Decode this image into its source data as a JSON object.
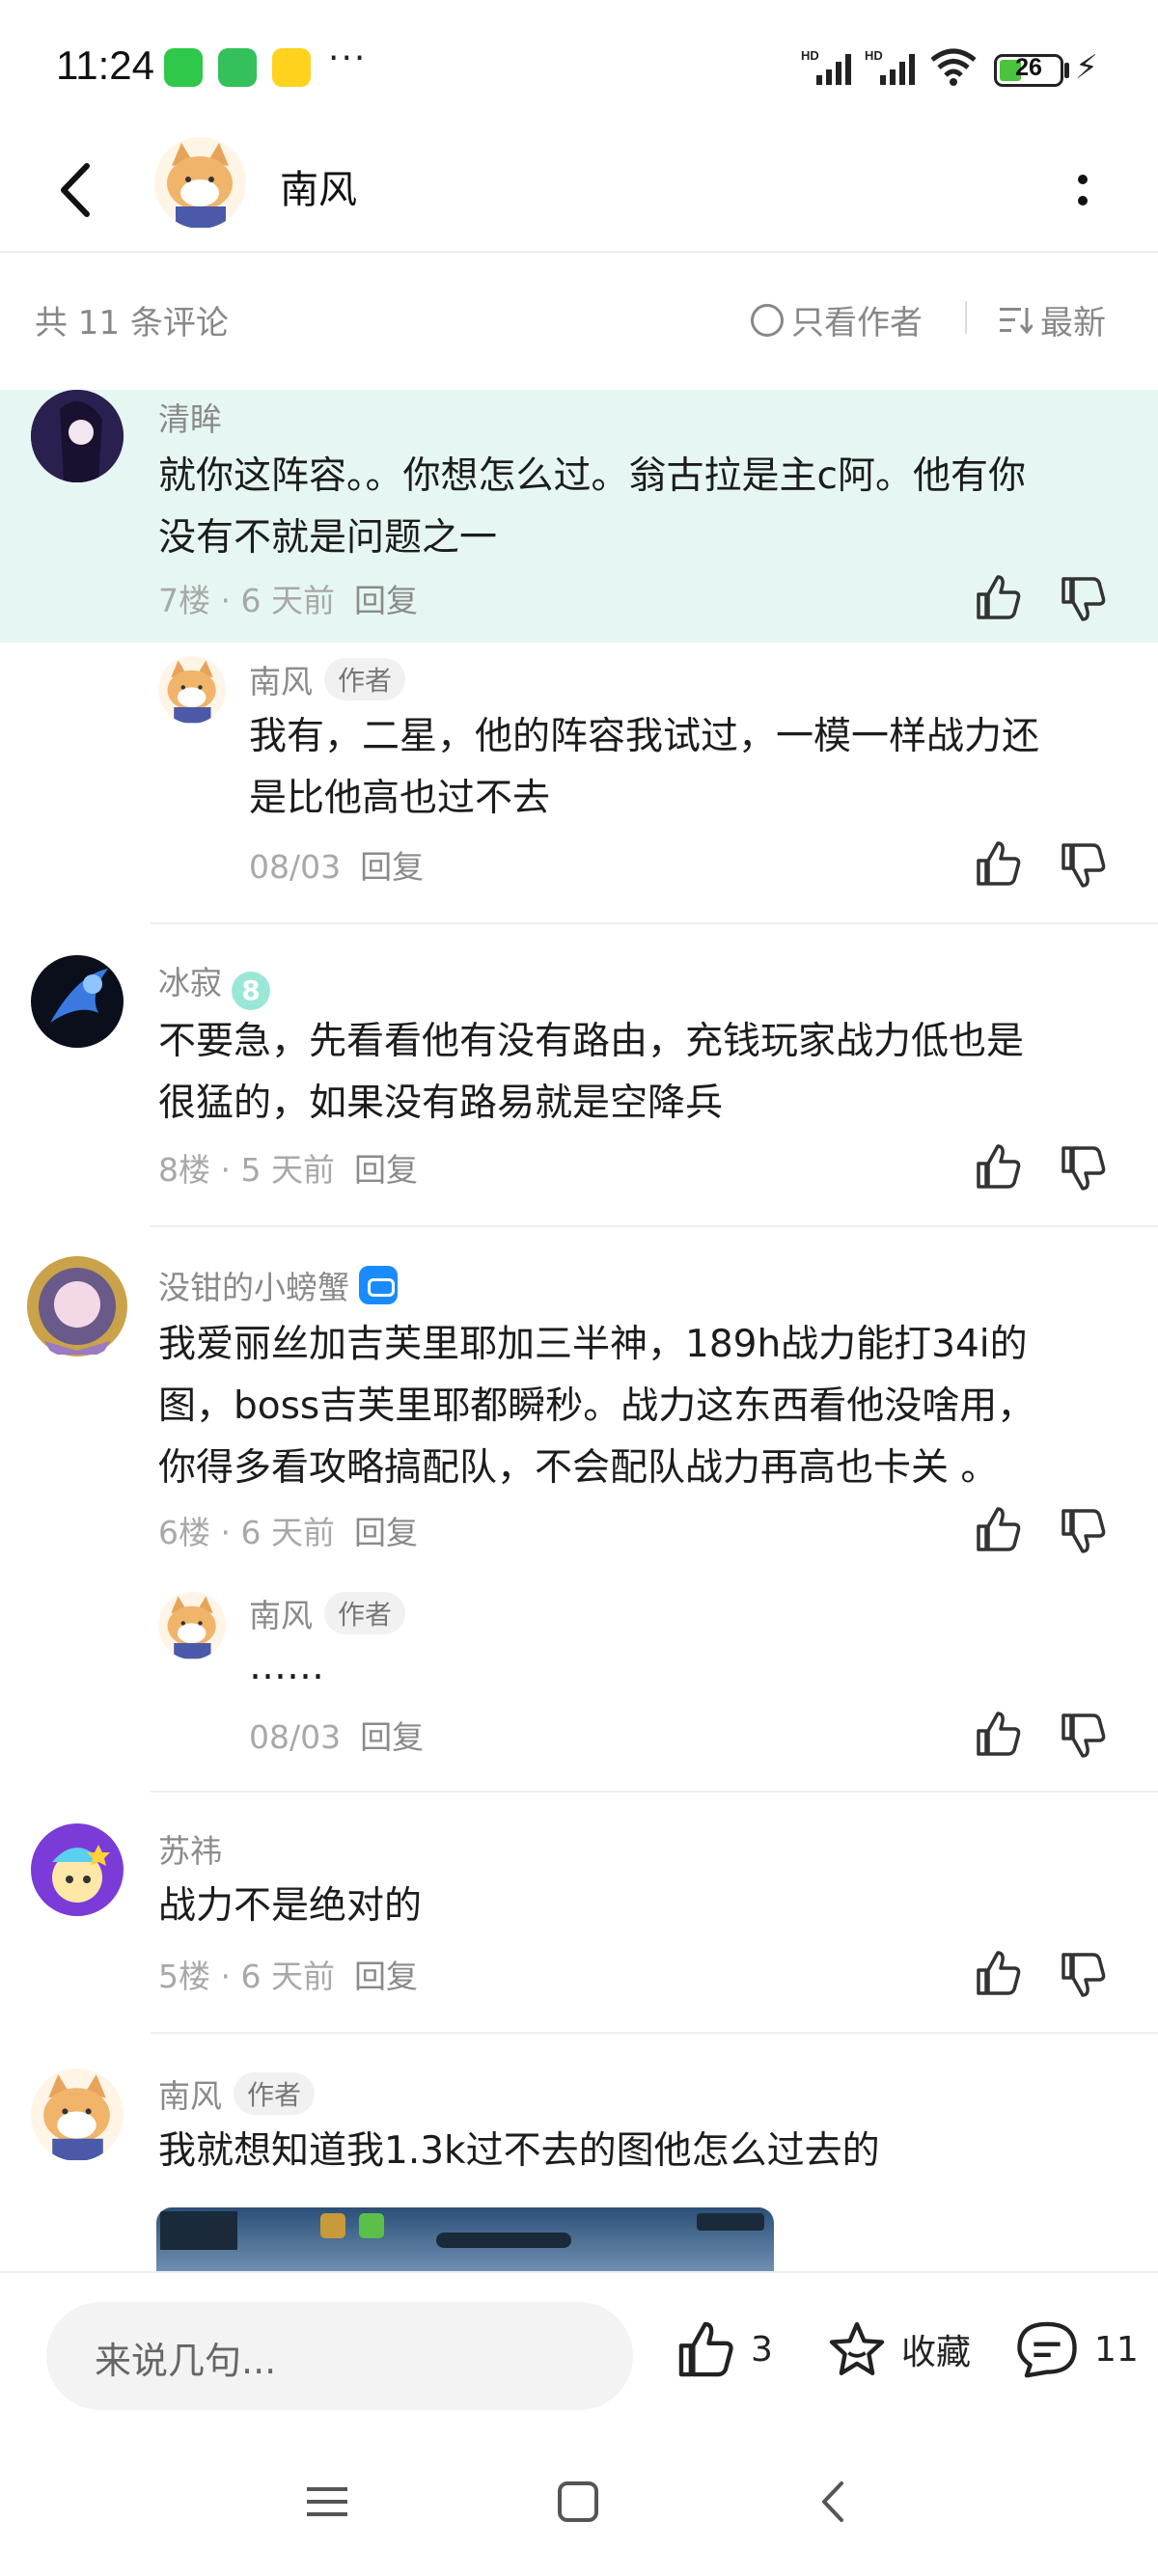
{
  "status_bar": {
    "time": "11:24",
    "battery": "26",
    "icons": [
      "wechat-icon",
      "shield-icon",
      "app-icon",
      "more-dots-icon",
      "signal-hd-icon",
      "signal-hd-icon",
      "wifi-icon",
      "battery-icon",
      "charging-icon"
    ],
    "dots": "···"
  },
  "header": {
    "title": "南风"
  },
  "filter": {
    "count_label": "共 11 条评论",
    "only_author_label": "只看作者",
    "sort_label": "最新"
  },
  "comments": [
    {
      "user": "清眸",
      "text_line1": "就你这阵容。。你想怎么过。翁古拉是主c阿。他有你",
      "text_line2": "没有不就是问题之一",
      "meta": "7楼 · 6 天前",
      "reply_label": "回复",
      "highlighted": true
    },
    {
      "user": "南风",
      "badge": "作者",
      "text_line1": "我有，二星，他的阵容我试过，一模一样战力还",
      "text_line2": "是比他高也过不去",
      "meta": "08/03",
      "reply_label": "回复"
    },
    {
      "user": "冰寂",
      "level": "8",
      "text_line1": "不要急，先看看他有没有路由，充钱玩家战力低也是",
      "text_line2": "很猛的，如果没有路易就是空降兵",
      "meta": "8楼 · 5 天前",
      "reply_label": "回复"
    },
    {
      "user": "没钳的小螃蟹",
      "text_line1": "我爱丽丝加吉芙里耶加三半神，189h战力能打34i的",
      "text_line2": "图，boss吉芙里耶都瞬秒。战力这东西看他没啥用，",
      "text_line3": "你得多看攻略搞配队，不会配队战力再高也卡关 。",
      "meta": "6楼 · 6 天前",
      "reply_label": "回复"
    },
    {
      "user": "南风",
      "badge": "作者",
      "text_line1": "……",
      "meta": "08/03",
      "reply_label": "回复"
    },
    {
      "user": "苏祎",
      "text_line1": "战力不是绝对的",
      "meta": "5楼 · 6 天前",
      "reply_label": "回复"
    },
    {
      "user": "南风",
      "badge": "作者",
      "text_line1": "我就想知道我1.3k过不去的图他怎么过去的"
    }
  ],
  "bottom_bar": {
    "input_placeholder": "来说几句...",
    "like_count": "3",
    "favorite_label": "收藏",
    "comment_count": "11"
  },
  "colors": {
    "highlight_bg": "#e6f7f3",
    "meta_gray": "#a8a8a8",
    "badge_bg": "#f1f1f1"
  }
}
